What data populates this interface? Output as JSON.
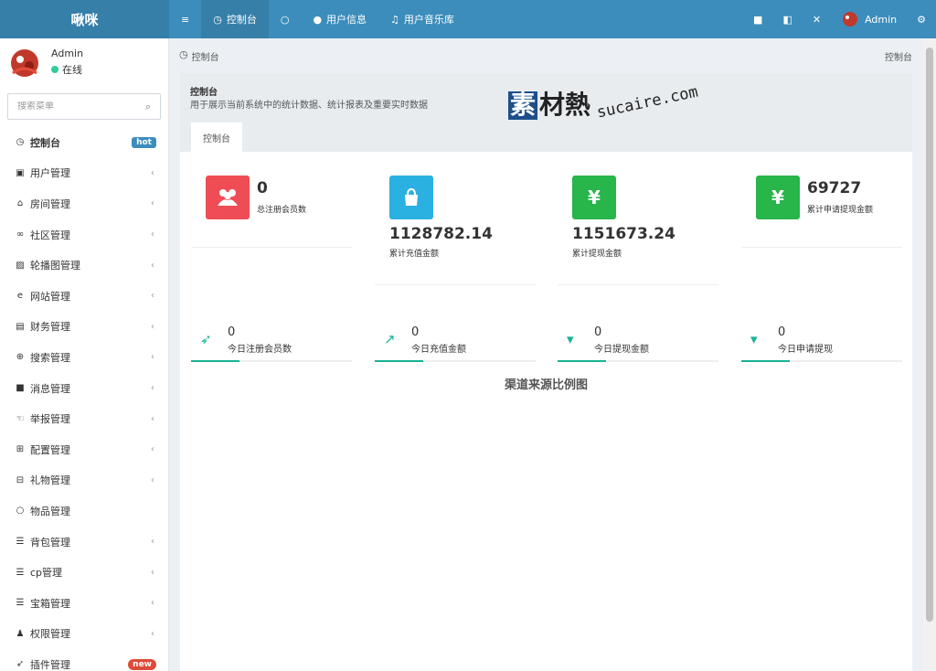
{
  "app": {
    "logo": "啾咪"
  },
  "topnav": [
    {
      "icon": "menu-icon",
      "glyph": "≡",
      "label": ""
    },
    {
      "icon": "dashboard-icon",
      "glyph": "◷",
      "label": "控制台",
      "active": true
    },
    {
      "icon": "circle-icon",
      "glyph": "○",
      "label": ""
    },
    {
      "icon": "user-icon",
      "glyph": "●",
      "label": "用户信息"
    },
    {
      "icon": "music-icon",
      "glyph": "♫",
      "label": "用户音乐库"
    }
  ],
  "topright": {
    "user": "Admin"
  },
  "sidebar": {
    "user_name": "Admin",
    "status": "在线",
    "search_placeholder": "搜索菜单",
    "items": [
      {
        "label": "控制台",
        "badge": "hot",
        "active": true
      },
      {
        "label": "用户管理"
      },
      {
        "label": "房间管理"
      },
      {
        "label": "社区管理"
      },
      {
        "label": "轮播图管理"
      },
      {
        "label": "网站管理"
      },
      {
        "label": "财务管理"
      },
      {
        "label": "搜索管理"
      },
      {
        "label": "消息管理"
      },
      {
        "label": "举报管理"
      },
      {
        "label": "配置管理"
      },
      {
        "label": "礼物管理"
      },
      {
        "label": "物品管理"
      },
      {
        "label": "背包管理"
      },
      {
        "label": "cp管理"
      },
      {
        "label": "宝箱管理"
      },
      {
        "label": "权限管理"
      },
      {
        "label": "插件管理",
        "badge": "new"
      }
    ]
  },
  "breadcrumb": {
    "left": "控制台",
    "right": "控制台"
  },
  "panel": {
    "title": "控制台",
    "desc": "用于展示当前系统中的统计数据、统计报表及重要实时数据",
    "tab": "控制台"
  },
  "watermark": {
    "a": "素",
    "b": "材熱",
    "c": "sucaire.com"
  },
  "stats": [
    {
      "value": "0",
      "label": "总注册会员数",
      "color": "#ee4d55"
    },
    {
      "value": "1128782.14",
      "label": "累计充值金额",
      "color": "#2bb0e2"
    },
    {
      "value": "1151673.24",
      "label": "累计提现金额",
      "color": "#28b54a"
    },
    {
      "value": "69727",
      "label": "累计申请提现金额",
      "color": "#28b54a"
    }
  ],
  "today": [
    {
      "value": "0",
      "label": "今日注册会员数"
    },
    {
      "value": "0",
      "label": "今日充值金额"
    },
    {
      "value": "0",
      "label": "今日提现金额"
    },
    {
      "value": "0",
      "label": "今日申请提现"
    }
  ],
  "chart": {
    "title": "渠道来源比例图"
  }
}
